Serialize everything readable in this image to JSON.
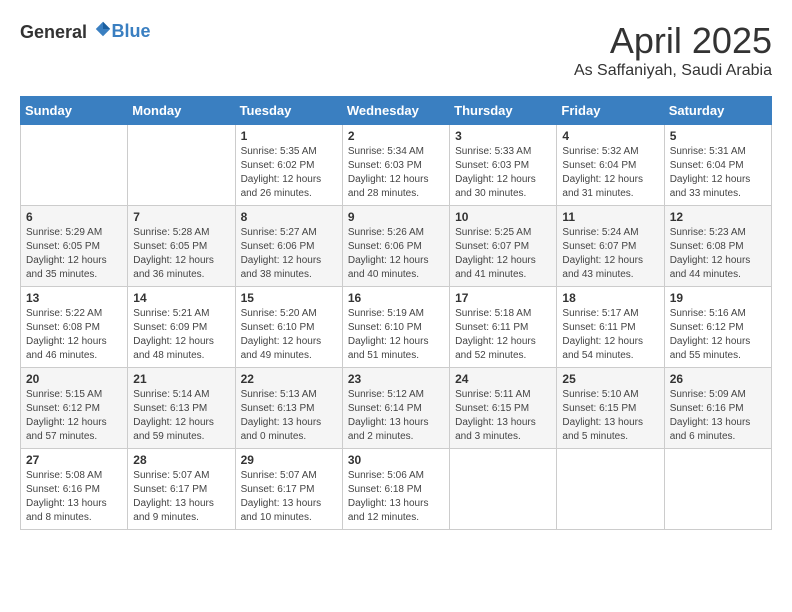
{
  "header": {
    "logo_general": "General",
    "logo_blue": "Blue",
    "month": "April 2025",
    "location": "As Saffaniyah, Saudi Arabia"
  },
  "days_of_week": [
    "Sunday",
    "Monday",
    "Tuesday",
    "Wednesday",
    "Thursday",
    "Friday",
    "Saturday"
  ],
  "weeks": [
    [
      {
        "day": "",
        "info": ""
      },
      {
        "day": "",
        "info": ""
      },
      {
        "day": "1",
        "info": "Sunrise: 5:35 AM\nSunset: 6:02 PM\nDaylight: 12 hours and 26 minutes."
      },
      {
        "day": "2",
        "info": "Sunrise: 5:34 AM\nSunset: 6:03 PM\nDaylight: 12 hours and 28 minutes."
      },
      {
        "day": "3",
        "info": "Sunrise: 5:33 AM\nSunset: 6:03 PM\nDaylight: 12 hours and 30 minutes."
      },
      {
        "day": "4",
        "info": "Sunrise: 5:32 AM\nSunset: 6:04 PM\nDaylight: 12 hours and 31 minutes."
      },
      {
        "day": "5",
        "info": "Sunrise: 5:31 AM\nSunset: 6:04 PM\nDaylight: 12 hours and 33 minutes."
      }
    ],
    [
      {
        "day": "6",
        "info": "Sunrise: 5:29 AM\nSunset: 6:05 PM\nDaylight: 12 hours and 35 minutes."
      },
      {
        "day": "7",
        "info": "Sunrise: 5:28 AM\nSunset: 6:05 PM\nDaylight: 12 hours and 36 minutes."
      },
      {
        "day": "8",
        "info": "Sunrise: 5:27 AM\nSunset: 6:06 PM\nDaylight: 12 hours and 38 minutes."
      },
      {
        "day": "9",
        "info": "Sunrise: 5:26 AM\nSunset: 6:06 PM\nDaylight: 12 hours and 40 minutes."
      },
      {
        "day": "10",
        "info": "Sunrise: 5:25 AM\nSunset: 6:07 PM\nDaylight: 12 hours and 41 minutes."
      },
      {
        "day": "11",
        "info": "Sunrise: 5:24 AM\nSunset: 6:07 PM\nDaylight: 12 hours and 43 minutes."
      },
      {
        "day": "12",
        "info": "Sunrise: 5:23 AM\nSunset: 6:08 PM\nDaylight: 12 hours and 44 minutes."
      }
    ],
    [
      {
        "day": "13",
        "info": "Sunrise: 5:22 AM\nSunset: 6:08 PM\nDaylight: 12 hours and 46 minutes."
      },
      {
        "day": "14",
        "info": "Sunrise: 5:21 AM\nSunset: 6:09 PM\nDaylight: 12 hours and 48 minutes."
      },
      {
        "day": "15",
        "info": "Sunrise: 5:20 AM\nSunset: 6:10 PM\nDaylight: 12 hours and 49 minutes."
      },
      {
        "day": "16",
        "info": "Sunrise: 5:19 AM\nSunset: 6:10 PM\nDaylight: 12 hours and 51 minutes."
      },
      {
        "day": "17",
        "info": "Sunrise: 5:18 AM\nSunset: 6:11 PM\nDaylight: 12 hours and 52 minutes."
      },
      {
        "day": "18",
        "info": "Sunrise: 5:17 AM\nSunset: 6:11 PM\nDaylight: 12 hours and 54 minutes."
      },
      {
        "day": "19",
        "info": "Sunrise: 5:16 AM\nSunset: 6:12 PM\nDaylight: 12 hours and 55 minutes."
      }
    ],
    [
      {
        "day": "20",
        "info": "Sunrise: 5:15 AM\nSunset: 6:12 PM\nDaylight: 12 hours and 57 minutes."
      },
      {
        "day": "21",
        "info": "Sunrise: 5:14 AM\nSunset: 6:13 PM\nDaylight: 12 hours and 59 minutes."
      },
      {
        "day": "22",
        "info": "Sunrise: 5:13 AM\nSunset: 6:13 PM\nDaylight: 13 hours and 0 minutes."
      },
      {
        "day": "23",
        "info": "Sunrise: 5:12 AM\nSunset: 6:14 PM\nDaylight: 13 hours and 2 minutes."
      },
      {
        "day": "24",
        "info": "Sunrise: 5:11 AM\nSunset: 6:15 PM\nDaylight: 13 hours and 3 minutes."
      },
      {
        "day": "25",
        "info": "Sunrise: 5:10 AM\nSunset: 6:15 PM\nDaylight: 13 hours and 5 minutes."
      },
      {
        "day": "26",
        "info": "Sunrise: 5:09 AM\nSunset: 6:16 PM\nDaylight: 13 hours and 6 minutes."
      }
    ],
    [
      {
        "day": "27",
        "info": "Sunrise: 5:08 AM\nSunset: 6:16 PM\nDaylight: 13 hours and 8 minutes."
      },
      {
        "day": "28",
        "info": "Sunrise: 5:07 AM\nSunset: 6:17 PM\nDaylight: 13 hours and 9 minutes."
      },
      {
        "day": "29",
        "info": "Sunrise: 5:07 AM\nSunset: 6:17 PM\nDaylight: 13 hours and 10 minutes."
      },
      {
        "day": "30",
        "info": "Sunrise: 5:06 AM\nSunset: 6:18 PM\nDaylight: 13 hours and 12 minutes."
      },
      {
        "day": "",
        "info": ""
      },
      {
        "day": "",
        "info": ""
      },
      {
        "day": "",
        "info": ""
      }
    ]
  ]
}
